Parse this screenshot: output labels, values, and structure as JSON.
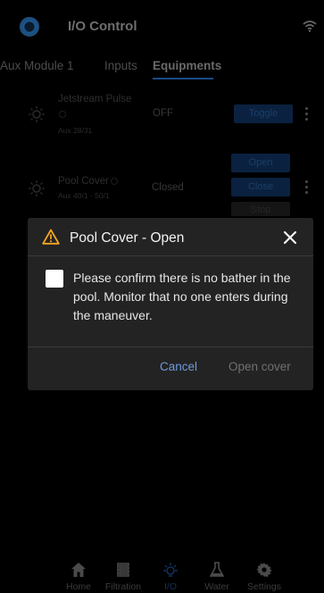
{
  "header": {
    "title": "I/O Control",
    "logo_icon": "circle-logo-icon",
    "wifi_icon": "wifi-icon"
  },
  "tabs": [
    {
      "label": "Aux Module 1",
      "active": false
    },
    {
      "label": "Inputs",
      "active": false
    },
    {
      "label": "Equipments",
      "active": true
    }
  ],
  "equipments": [
    {
      "name": "Jetstream Pulse",
      "subtitle": "Aux 28/31",
      "state": "OFF",
      "buttons": [
        "Toggle"
      ]
    },
    {
      "name": "Pool Cover",
      "subtitle": "Aux 40/1 - 50/1",
      "state": "Closed",
      "buttons": [
        "Open",
        "Close",
        "Stop"
      ]
    }
  ],
  "nav": [
    {
      "label": "Home",
      "icon": "home-icon",
      "active": false
    },
    {
      "label": "Filtration",
      "icon": "filtration-icon",
      "active": false
    },
    {
      "label": "I/O",
      "icon": "bulb-icon",
      "active": true
    },
    {
      "label": "Water",
      "icon": "flask-icon",
      "active": false
    },
    {
      "label": "Settings",
      "icon": "gear-icon",
      "active": false
    }
  ],
  "dialog": {
    "title": "Pool Cover - Open",
    "icon": "warning-icon",
    "message": "Please confirm there is no bather in the pool. Monitor that no one enters during the maneuver.",
    "checkbox_checked": false,
    "cancel_label": "Cancel",
    "confirm_label": "Open cover"
  },
  "colors": {
    "accent": "#6c9bdc",
    "warning": "#f5a623",
    "dialog_bg": "#232323"
  }
}
